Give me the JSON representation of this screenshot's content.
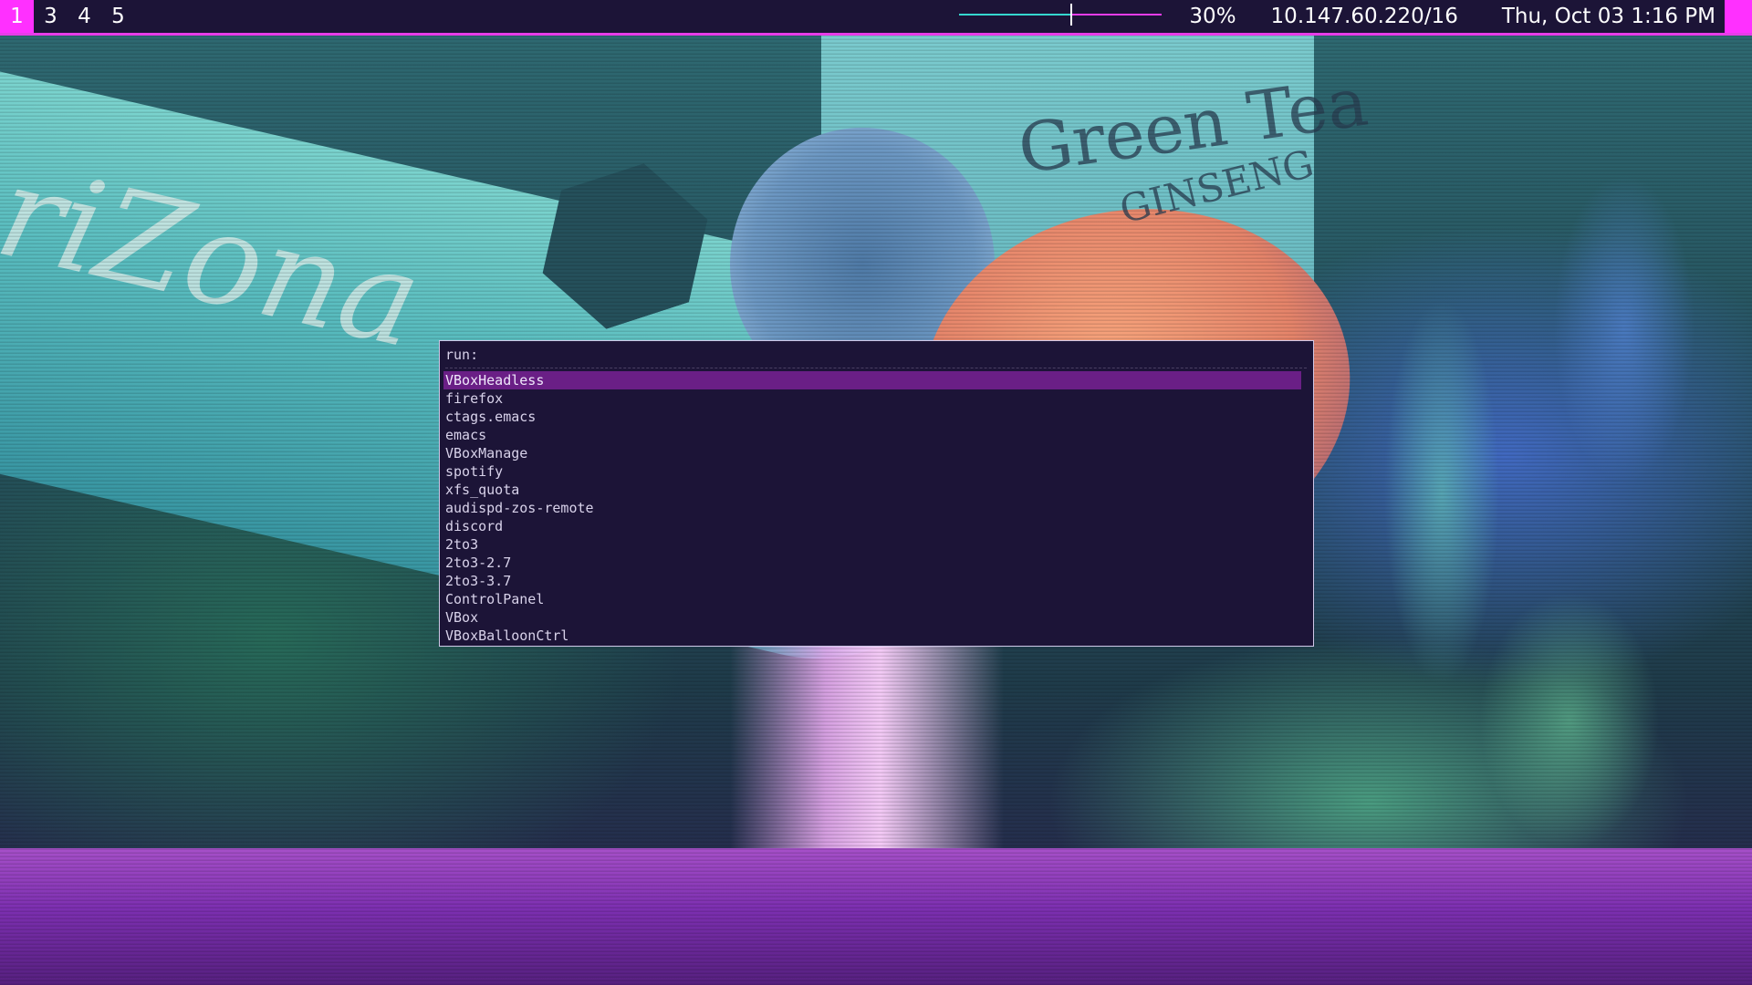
{
  "topbar": {
    "workspaces": [
      {
        "label": "1",
        "active": true
      },
      {
        "label": "3",
        "active": false
      },
      {
        "label": "4",
        "active": false
      },
      {
        "label": "5",
        "active": false
      }
    ],
    "volume_level": 0.55,
    "battery": "30%",
    "network": "10.147.60.220/16",
    "datetime": "Thu, Oct 03  1:16 PM"
  },
  "launcher": {
    "prompt": "run:",
    "selected_index": 0,
    "results": [
      "VBoxHeadless",
      "firefox",
      "ctags.emacs",
      "emacs",
      "VBoxManage",
      "spotify",
      "xfs_quota",
      "audispd-zos-remote",
      "discord",
      "2to3",
      "2to3-2.7",
      "2to3-3.7",
      "ControlPanel",
      "VBox",
      "VBoxBalloonCtrl"
    ]
  },
  "wallpaper": {
    "brand_text": "riZona",
    "can_text_1": "Green Tea",
    "can_text_2": "GINSENG"
  },
  "colors": {
    "bar_bg": "#1c1437",
    "accent_magenta": "#ff30ff",
    "accent_teal": "#35d7cf",
    "selection": "#6a1f86"
  }
}
